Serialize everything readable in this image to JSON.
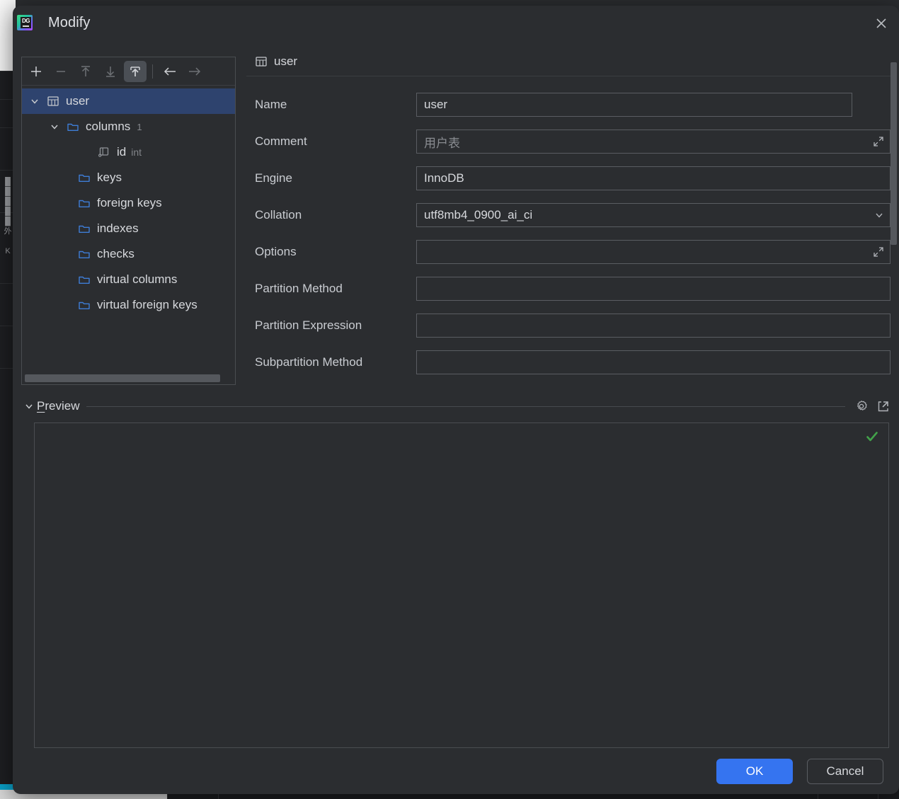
{
  "window": {
    "title": "Modify",
    "app_icon": "datagrip-logo",
    "logo_text": "DG",
    "close_icon": "close-icon"
  },
  "tree_toolbar": {
    "buttons": [
      {
        "name": "add-button",
        "icon": "plus-icon",
        "enabled": true,
        "active": false
      },
      {
        "name": "remove-button",
        "icon": "minus-icon",
        "enabled": false,
        "active": false
      },
      {
        "name": "move-up-button",
        "icon": "arrow-up-to-bar-icon",
        "enabled": false,
        "active": false
      },
      {
        "name": "move-down-button",
        "icon": "arrow-down-to-bar-icon",
        "enabled": false,
        "active": false
      },
      {
        "name": "extract-button",
        "icon": "arrow-up-into-tray-icon",
        "enabled": true,
        "active": true
      },
      {
        "name": "navigate-back-button",
        "icon": "arrow-left-icon",
        "enabled": true,
        "active": false
      },
      {
        "name": "navigate-forward-button",
        "icon": "arrow-right-icon",
        "enabled": false,
        "active": false
      }
    ]
  },
  "tree": {
    "nodes": [
      {
        "label": "user",
        "icon": "table-icon",
        "indent": 0,
        "expanded": true,
        "selected": true,
        "count": "",
        "type": ""
      },
      {
        "label": "columns",
        "icon": "folder-icon",
        "indent": 1,
        "expanded": true,
        "selected": false,
        "count": "1",
        "type": ""
      },
      {
        "label": "id",
        "icon": "column-icon",
        "indent": 2,
        "expanded": null,
        "selected": false,
        "count": "",
        "type": "int"
      },
      {
        "label": "keys",
        "icon": "folder-icon",
        "indent": 1,
        "expanded": null,
        "selected": false,
        "count": "",
        "type": ""
      },
      {
        "label": "foreign keys",
        "icon": "folder-icon",
        "indent": 1,
        "expanded": null,
        "selected": false,
        "count": "",
        "type": ""
      },
      {
        "label": "indexes",
        "icon": "folder-icon",
        "indent": 1,
        "expanded": null,
        "selected": false,
        "count": "",
        "type": ""
      },
      {
        "label": "checks",
        "icon": "folder-icon",
        "indent": 1,
        "expanded": null,
        "selected": false,
        "count": "",
        "type": ""
      },
      {
        "label": "virtual columns",
        "icon": "folder-icon",
        "indent": 1,
        "expanded": null,
        "selected": false,
        "count": "",
        "type": ""
      },
      {
        "label": "virtual foreign keys",
        "icon": "folder-icon",
        "indent": 1,
        "expanded": null,
        "selected": false,
        "count": "",
        "type": ""
      }
    ]
  },
  "form": {
    "header_icon": "table-icon",
    "header_title": "user",
    "fields": [
      {
        "name": "name",
        "label": "Name",
        "value": "user",
        "placeholder": "",
        "kind": "text",
        "menu": true,
        "expand": false
      },
      {
        "name": "comment",
        "label": "Comment",
        "value": "",
        "placeholder": "用户表",
        "kind": "textarea",
        "menu": false,
        "expand": true
      },
      {
        "name": "engine",
        "label": "Engine",
        "value": "InnoDB",
        "placeholder": "",
        "kind": "text",
        "menu": false,
        "expand": false
      },
      {
        "name": "collation",
        "label": "Collation",
        "value": "utf8mb4_0900_ai_ci",
        "placeholder": "",
        "kind": "select",
        "menu": false,
        "expand": false
      },
      {
        "name": "options",
        "label": "Options",
        "value": "",
        "placeholder": "",
        "kind": "textarea",
        "menu": false,
        "expand": true
      },
      {
        "name": "partition-method",
        "label": "Partition Method",
        "value": "",
        "placeholder": "",
        "kind": "text",
        "menu": false,
        "expand": false
      },
      {
        "name": "partition-expression",
        "label": "Partition Expression",
        "value": "",
        "placeholder": "",
        "kind": "text",
        "menu": false,
        "expand": false
      },
      {
        "name": "subpartition-method",
        "label": "Subpartition Method",
        "value": "",
        "placeholder": "",
        "kind": "text",
        "menu": false,
        "expand": false
      }
    ]
  },
  "preview": {
    "label": "Preview",
    "label_mnemonic": "P",
    "label_rest": "review",
    "collapse_icon": "chevron-down-icon",
    "settings_icon": "gear-icon",
    "popout_icon": "open-in-new-window-icon",
    "status_icon": "checkmark-icon",
    "body_text": ""
  },
  "footer": {
    "ok_label": "OK",
    "cancel_label": "Cancel"
  },
  "colors": {
    "accent_blue": "#3574f0",
    "selection_blue": "#2e436e",
    "folder_blue": "#3e7dd6",
    "status_green": "#42a24a",
    "dialog_bg": "#2b2d30",
    "field_border": "#5a5d62",
    "text_primary": "#d7d9dd",
    "text_muted": "#85888d",
    "progress_teal": "#0aa0c8"
  }
}
